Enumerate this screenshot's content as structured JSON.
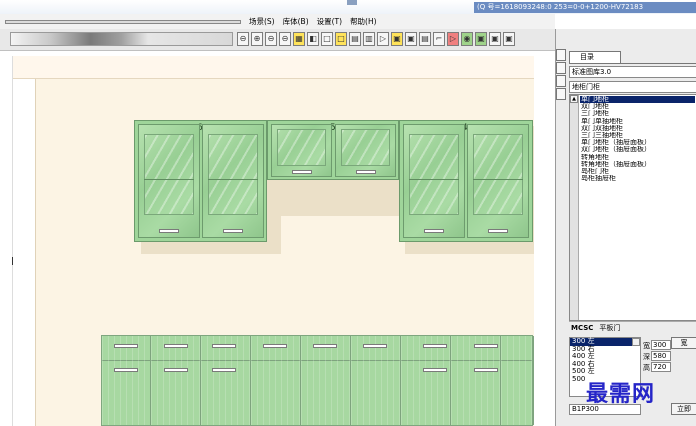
{
  "titlebar": {
    "status": "(Q 号=1618093248:0 253=0-0+1200-HV72183"
  },
  "menu": {
    "items": [
      "场景(S)",
      "库体(B)",
      "设置(T)",
      "帮助(H)"
    ]
  },
  "toolbar": {
    "tools": [
      "⊖",
      "⊕",
      "⊖",
      "⊖",
      "▦",
      "◧",
      "□",
      "□",
      "▤",
      "▥",
      "▷",
      "▣",
      "▣",
      "▤",
      "⌐",
      "▷",
      "◉",
      "▣",
      "▣",
      "▣"
    ]
  },
  "cabinets": {
    "upper_numbers": [
      "6",
      "5",
      "4"
    ]
  },
  "panel": {
    "tab_label": "目录",
    "library": "标准图库3.0",
    "category": "地柜门柜",
    "items": [
      "单门地柜",
      "双门地柜",
      "三门地柜",
      "单门单抽地柜",
      "双门双抽地柜",
      "三门三抽地柜",
      "单门地柜（抽屉面板）",
      "双门地柜（抽屉面板）",
      "转角地柜",
      "转角地柜（抽屉面板）",
      "岛柜门柜",
      "岛柜抽屉柜"
    ],
    "selected_index": 0,
    "mcsc_label": "MCSC",
    "door_type": "平板门",
    "sizes": [
      "300 左",
      "300 右",
      "400 左",
      "400 右",
      "500 左",
      "500"
    ],
    "selected_size_index": 0,
    "code": "B1P300",
    "dim_labels": [
      "宽",
      "深",
      "高"
    ],
    "dims": [
      "300",
      "580",
      "720"
    ],
    "btn_top": "宽",
    "btn_bottom": "立即"
  },
  "watermark": "最需网"
}
